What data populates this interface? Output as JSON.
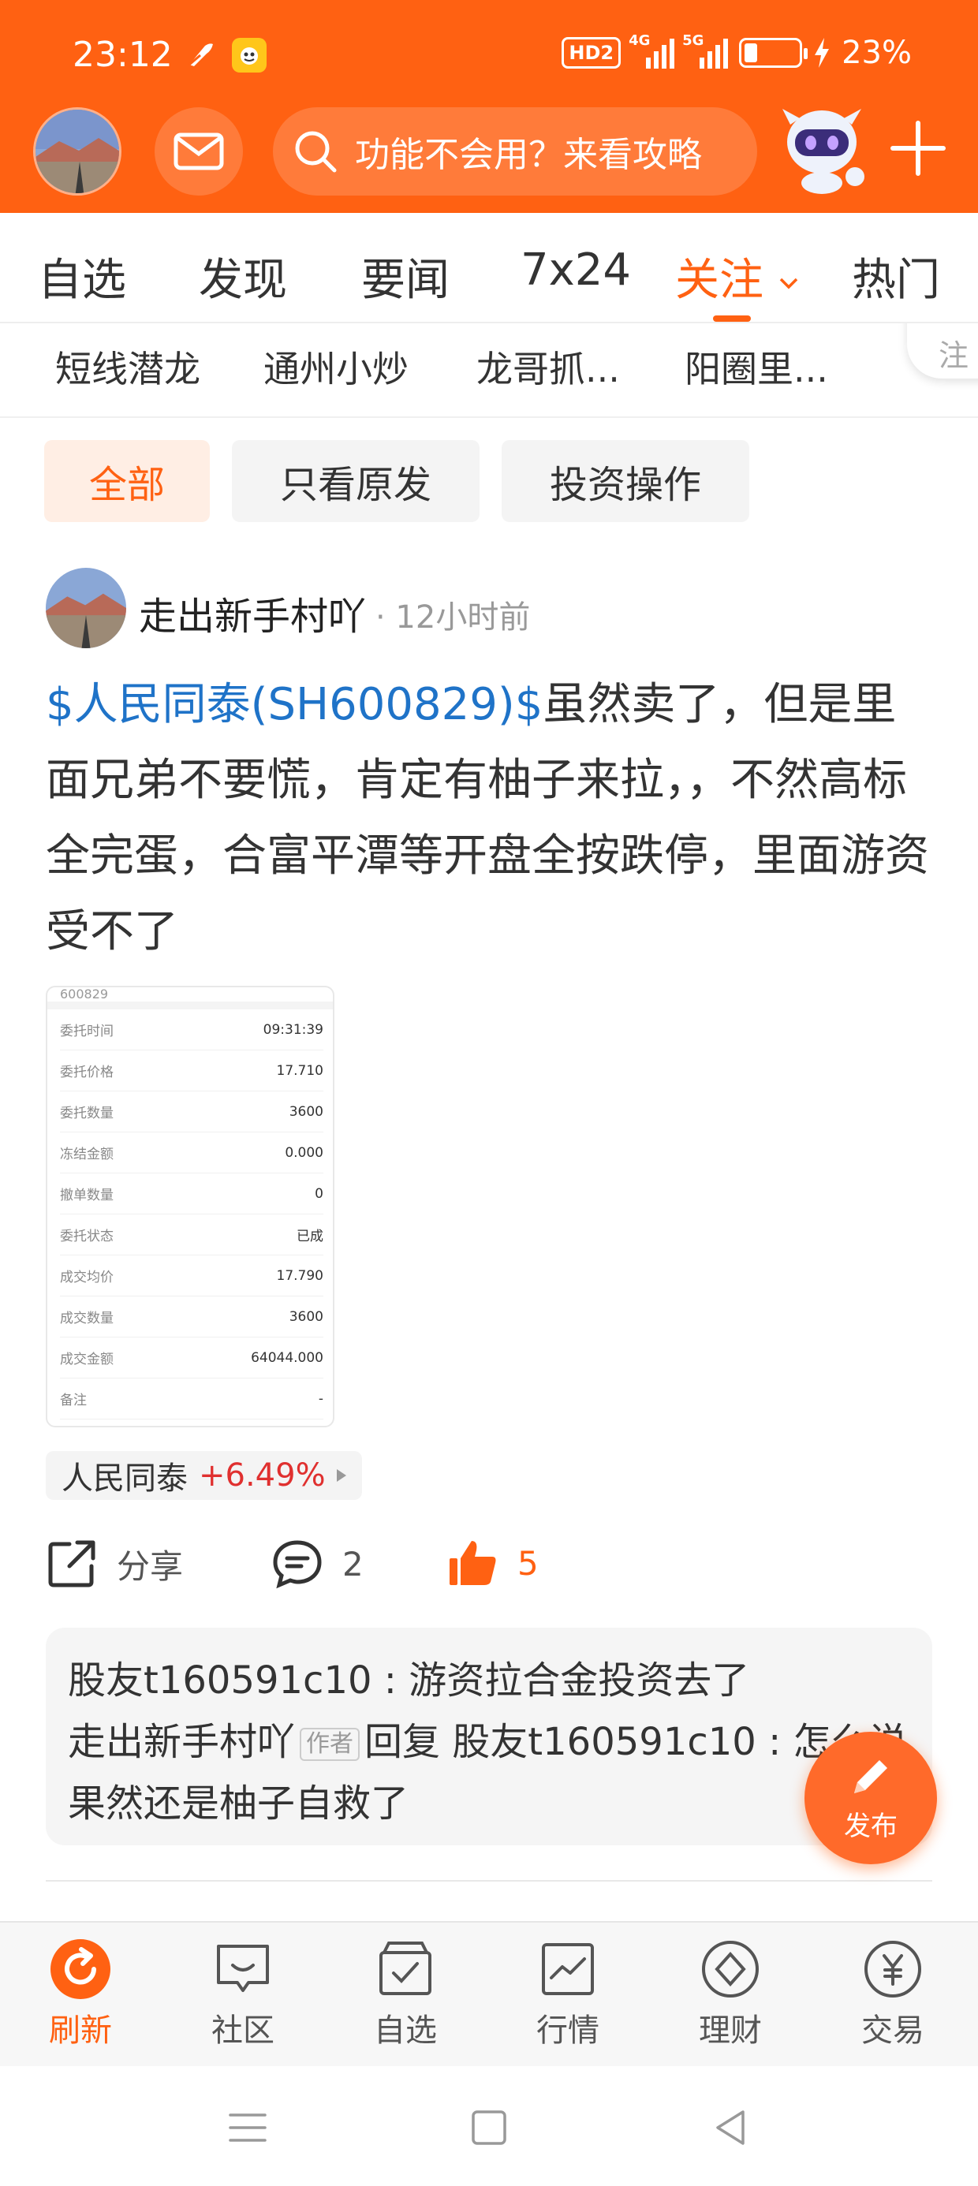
{
  "status_bar": {
    "time": "23:12",
    "hd_badge": "HD2",
    "network_a": "4G",
    "network_b": "5G",
    "battery": "23%"
  },
  "header": {
    "search_placeholder": "功能不会用？来看攻略",
    "brand_color": "#ff6112",
    "icons": [
      "avatar",
      "mail-icon",
      "search-icon",
      "mascot",
      "plus-icon"
    ]
  },
  "tabs": [
    {
      "label": "自选"
    },
    {
      "label": "发现"
    },
    {
      "label": "要闻"
    },
    {
      "label": "7x24"
    },
    {
      "label": "关注",
      "active": true
    },
    {
      "label": "热门"
    }
  ],
  "followed_users": [
    "短线潜龙",
    "通州小炒",
    "龙哥抓...",
    "阳圈里..."
  ],
  "followed_more": "注",
  "filters": [
    {
      "label": "全部",
      "active": true
    },
    {
      "label": "只看原发"
    },
    {
      "label": "投资操作"
    }
  ],
  "post": {
    "author": "走出新手村吖",
    "time": "· 12小时前",
    "stock_link": "$人民同泰(SH600829)$",
    "text": "虽然卖了，但是里面兄弟不要慌，肯定有柚子来拉，，不然高标全完蛋，合富平潭等开盘全按跌停，里面游资受不了",
    "trade_card": {
      "code": "600829",
      "rows": [
        {
          "k": "委托时间",
          "v": "09:31:39"
        },
        {
          "k": "委托价格",
          "v": "17.710"
        },
        {
          "k": "委托数量",
          "v": "3600"
        },
        {
          "k": "冻结金额",
          "v": "0.000"
        },
        {
          "k": "撤单数量",
          "v": "0"
        },
        {
          "k": "委托状态",
          "v": "已成"
        },
        {
          "k": "成交均价",
          "v": "17.790"
        },
        {
          "k": "成交数量",
          "v": "3600"
        },
        {
          "k": "成交金额",
          "v": "64044.000"
        },
        {
          "k": "备注",
          "v": "-"
        }
      ]
    },
    "stock_chip": {
      "name": "人民同泰",
      "change": "+6.49%",
      "change_color": "#e0302f"
    },
    "actions": {
      "share_label": "分享",
      "comment_count": "2",
      "like_count": "5"
    },
    "comments": [
      {
        "user": "股友t160591c10",
        "sep": " : ",
        "text": "游资拉合金投资去了"
      },
      {
        "user": "走出新手村吖",
        "tag": "作者",
        "reply_word": "回复",
        "reply_to": "股友t160591c10",
        "sep": " : ",
        "text": "怎么说",
        "cont": "果然还是柚子自救了"
      }
    ]
  },
  "fab": {
    "label": "发布"
  },
  "bottom_nav": [
    {
      "label": "刷新",
      "icon": "refresh-icon",
      "active": true
    },
    {
      "label": "社区",
      "icon": "community-icon"
    },
    {
      "label": "自选",
      "icon": "watchlist-icon"
    },
    {
      "label": "行情",
      "icon": "market-icon"
    },
    {
      "label": "理财",
      "icon": "wealth-icon"
    },
    {
      "label": "交易",
      "icon": "trade-icon"
    }
  ]
}
